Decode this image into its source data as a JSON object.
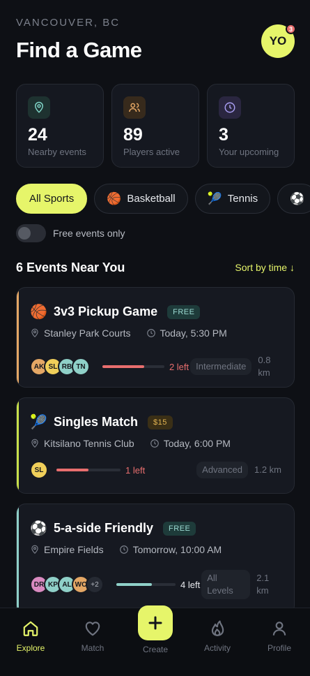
{
  "header": {
    "location": "VANCOUVER, BC",
    "title": "Find a Game",
    "avatar_initials": "YO",
    "notification_count": "3"
  },
  "stats": [
    {
      "icon": "location-pin-icon",
      "value": "24",
      "label": "Nearby events",
      "color": "#7ed3c5"
    },
    {
      "icon": "users-icon",
      "value": "89",
      "label": "Players active",
      "color": "#e4a765"
    },
    {
      "icon": "clock-icon",
      "value": "3",
      "label": "Your upcoming",
      "color": "#a79cf0"
    }
  ],
  "filters": {
    "chips": [
      {
        "label": "All Sports",
        "emoji": ""
      },
      {
        "label": "Basketball",
        "emoji": "🏀"
      },
      {
        "label": "Tennis",
        "emoji": "🎾"
      },
      {
        "label": "",
        "emoji": "⚽"
      }
    ],
    "free_toggle_label": "Free events only"
  },
  "section": {
    "title": "6 Events Near You",
    "sort_label": "Sort by time ↓"
  },
  "events": [
    {
      "emoji": "🏀",
      "title": "3v3 Pickup Game",
      "price": "FREE",
      "location": "Stanley Park Courts",
      "time": "Today, 5:30 PM",
      "players": [
        "AK",
        "SL",
        "RB",
        "TN"
      ],
      "player_colors": [
        "#e4a765",
        "#f0cf5a",
        "#8fd0c8",
        "#8fd0c8"
      ],
      "more": "",
      "spots_left": "2 left",
      "fill_fraction": 0.67,
      "level": "Intermediate",
      "distance": "0.8 km",
      "stripe": "#e4a765",
      "bar_color": "#e86e6e"
    },
    {
      "emoji": "🎾",
      "title": "Singles Match",
      "price": "$15",
      "location": "Kitsilano Tennis Club",
      "time": "Today, 6:00 PM",
      "players": [
        "SL"
      ],
      "player_colors": [
        "#f0cf5a"
      ],
      "more": "",
      "spots_left": "1 left",
      "fill_fraction": 0.5,
      "level": "Advanced",
      "distance": "1.2 km",
      "stripe": "#c8e04a",
      "bar_color": "#e86e6e"
    },
    {
      "emoji": "⚽",
      "title": "5-a-side Friendly",
      "price": "FREE",
      "location": "Empire Fields",
      "time": "Tomorrow, 10:00 AM",
      "players": [
        "DR",
        "KP",
        "AL",
        "WC"
      ],
      "player_colors": [
        "#d98ac0",
        "#8fd0c8",
        "#8fd0c8",
        "#e4a765"
      ],
      "more": "+2",
      "spots_left": "4 left",
      "fill_fraction": 0.6,
      "level": "All Levels",
      "distance": "2.1 km",
      "stripe": "#8fd0c8",
      "bar_color": "#8fd0c8"
    }
  ],
  "tabbar": {
    "tabs": [
      {
        "label": "Explore",
        "icon": "home-icon"
      },
      {
        "label": "Match",
        "icon": "heart-icon"
      },
      {
        "label": "Create",
        "icon": "plus-icon"
      },
      {
        "label": "Activity",
        "icon": "flame-icon"
      },
      {
        "label": "Profile",
        "icon": "user-icon"
      }
    ]
  }
}
